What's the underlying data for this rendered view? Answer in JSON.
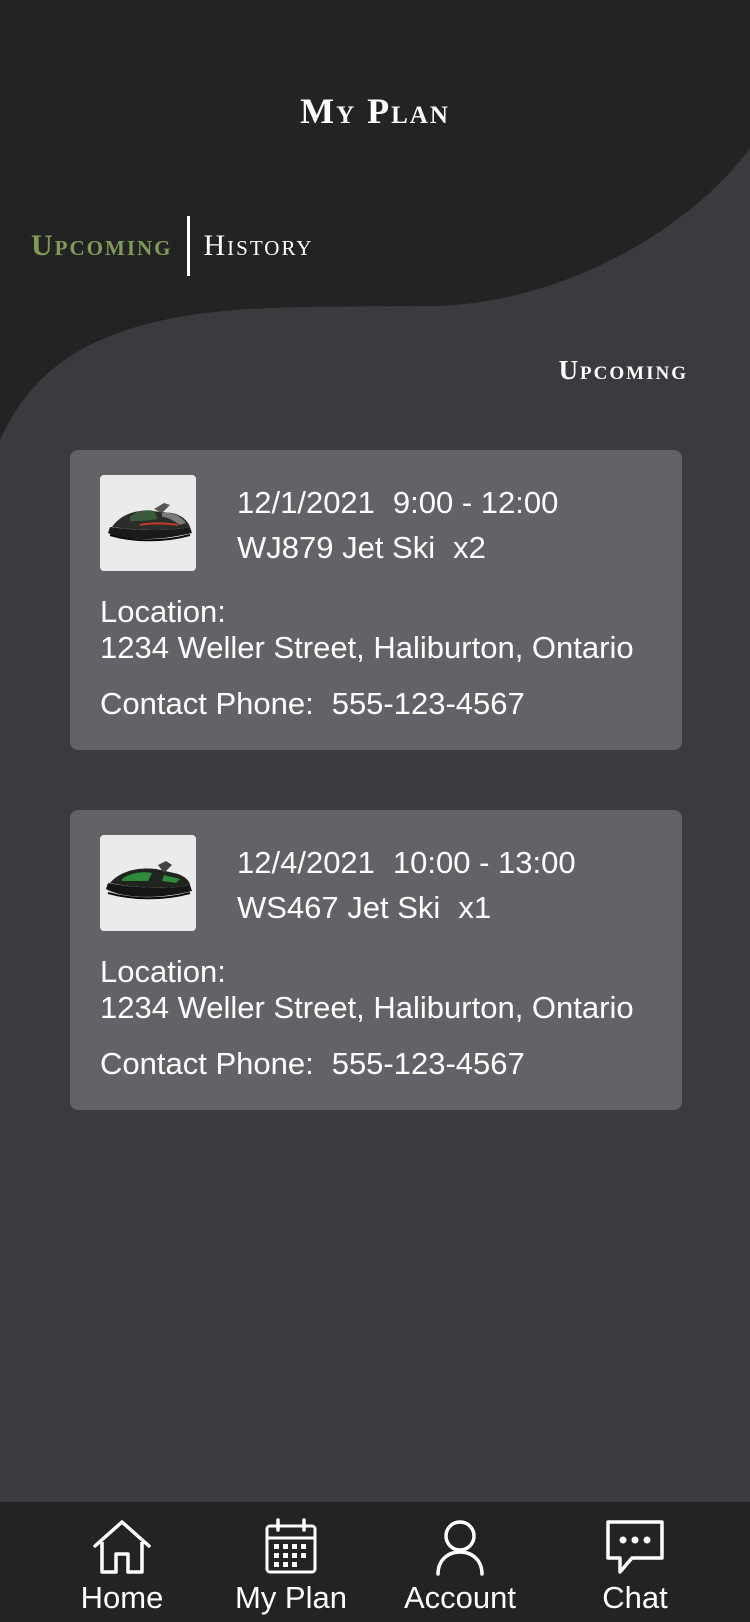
{
  "header": {
    "title": "My Plan"
  },
  "tabs": {
    "upcoming": "Upcoming",
    "history": "History",
    "active": "upcoming",
    "active_color": "#7f9a5b"
  },
  "section_label": "Upcoming",
  "bookings": [
    {
      "date": "12/1/2021",
      "time": "9:00 - 12:00",
      "model": "WJ879 Jet Ski",
      "quantity": "x2",
      "location_label": "Location:",
      "location": "1234 Weller Street, Haliburton, Ontario",
      "phone_label": "Contact Phone:",
      "phone": "555-123-4567",
      "image_icon": "jet-ski-image"
    },
    {
      "date": "12/4/2021",
      "time": "10:00 - 13:00",
      "model": "WS467 Jet Ski",
      "quantity": "x1",
      "location_label": "Location:",
      "location": "1234 Weller Street, Haliburton, Ontario",
      "phone_label": "Contact Phone:",
      "phone": "555-123-4567",
      "image_icon": "jet-ski-image"
    }
  ],
  "nav": [
    {
      "label": "Home",
      "icon": "home-icon"
    },
    {
      "label": "My Plan",
      "icon": "calendar-icon"
    },
    {
      "label": "Account",
      "icon": "user-icon"
    },
    {
      "label": "Chat",
      "icon": "chat-icon"
    }
  ],
  "colors": {
    "background": "#3a3b3e",
    "header": "#232324",
    "card": "#626366",
    "accent": "#7f9a5b"
  }
}
